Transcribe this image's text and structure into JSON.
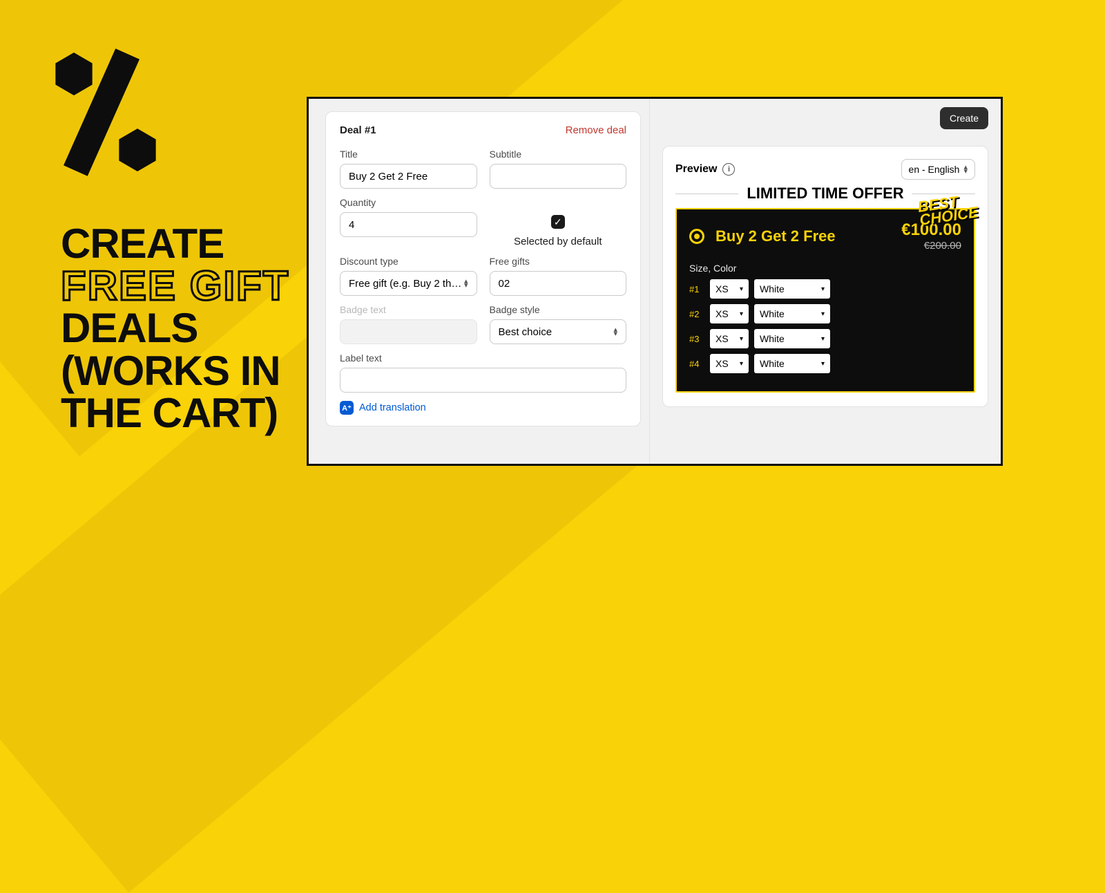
{
  "headline": {
    "l1": "CREATE",
    "l2": "FREE GIFT",
    "l3": "DEALS",
    "l4": "(WORKS IN",
    "l5": "THE CART)"
  },
  "card": {
    "title": "Deal #1",
    "remove": "Remove deal",
    "titleField": {
      "label": "Title",
      "value": "Buy 2 Get 2 Free"
    },
    "subtitleField": {
      "label": "Subtitle",
      "value": ""
    },
    "quantity": {
      "label": "Quantity",
      "value": "4"
    },
    "selectedDefault": "Selected by default",
    "discountType": {
      "label": "Discount type",
      "value": "Free gift (e.g. Buy 2 th…"
    },
    "freeGifts": {
      "label": "Free gifts",
      "value": "02"
    },
    "badgeText": {
      "label": "Badge text"
    },
    "badgeStyle": {
      "label": "Badge style",
      "value": "Best choice"
    },
    "labelText": {
      "label": "Label text",
      "value": ""
    },
    "addTranslation": "Add translation"
  },
  "right": {
    "create": "Create",
    "preview": "Preview",
    "lang": "en - English",
    "offerTitle": "LIMITED TIME OFFER",
    "bestBadge": "BEST\nCHOICE",
    "dealName": "Buy 2 Get 2 Free",
    "price": "€100.00",
    "oldPrice": "€200.00",
    "sizeColor": "Size, Color",
    "variants": [
      {
        "n": "#1",
        "size": "XS",
        "color": "White"
      },
      {
        "n": "#2",
        "size": "XS",
        "color": "White"
      },
      {
        "n": "#3",
        "size": "XS",
        "color": "White"
      },
      {
        "n": "#4",
        "size": "XS",
        "color": "White"
      }
    ]
  }
}
